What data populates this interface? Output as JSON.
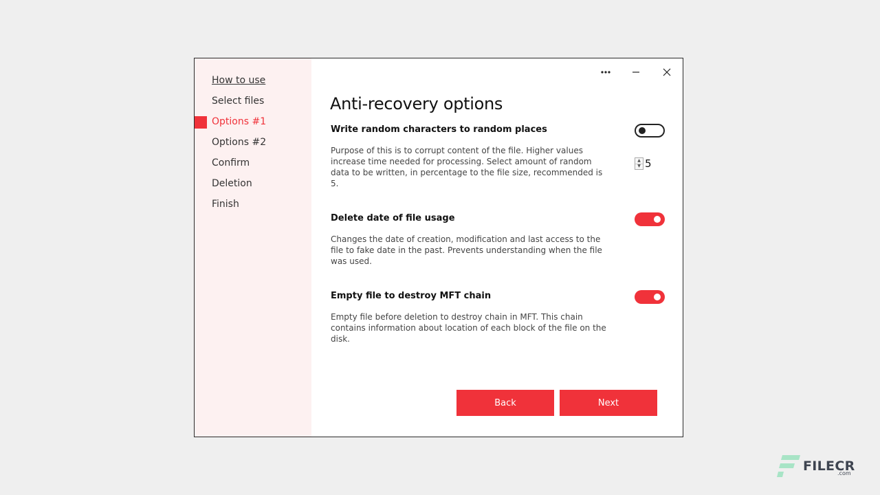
{
  "sidebar": {
    "items": [
      {
        "label": "How to use"
      },
      {
        "label": "Select files"
      },
      {
        "label": "Options #1"
      },
      {
        "label": "Options #2"
      },
      {
        "label": "Confirm"
      },
      {
        "label": "Deletion"
      },
      {
        "label": "Finish"
      }
    ],
    "active_index": 2
  },
  "titlebar": {
    "more_icon": "ellipsis-icon",
    "minimize_icon": "minimize-icon",
    "close_icon": "close-icon"
  },
  "main": {
    "title": "Anti-recovery options",
    "options": [
      {
        "title": "Write random characters to random places",
        "description": "Purpose of this is to corrupt content of the file. Higher values increase time needed for processing. Select amount of random data to be written, in percentage to the file size, recommended is 5.",
        "enabled": false,
        "stepper_value": "5"
      },
      {
        "title": "Delete date of file usage",
        "description": "Changes the date of creation, modification and last access to the file to fake date in the past. Prevents understanding when the file was used.",
        "enabled": true
      },
      {
        "title": "Empty file to destroy MFT chain",
        "description": "Empty file before deletion to destroy chain in MFT. This chain contains information about location of each block of the file on the disk.",
        "enabled": true
      }
    ],
    "buttons": {
      "back": "Back",
      "next": "Next"
    }
  },
  "watermark": {
    "text": "FILECR",
    "sub": ".com"
  },
  "colors": {
    "accent": "#f0323a",
    "sidebar_bg": "#fdf1f1",
    "page_bg": "#efefef"
  }
}
